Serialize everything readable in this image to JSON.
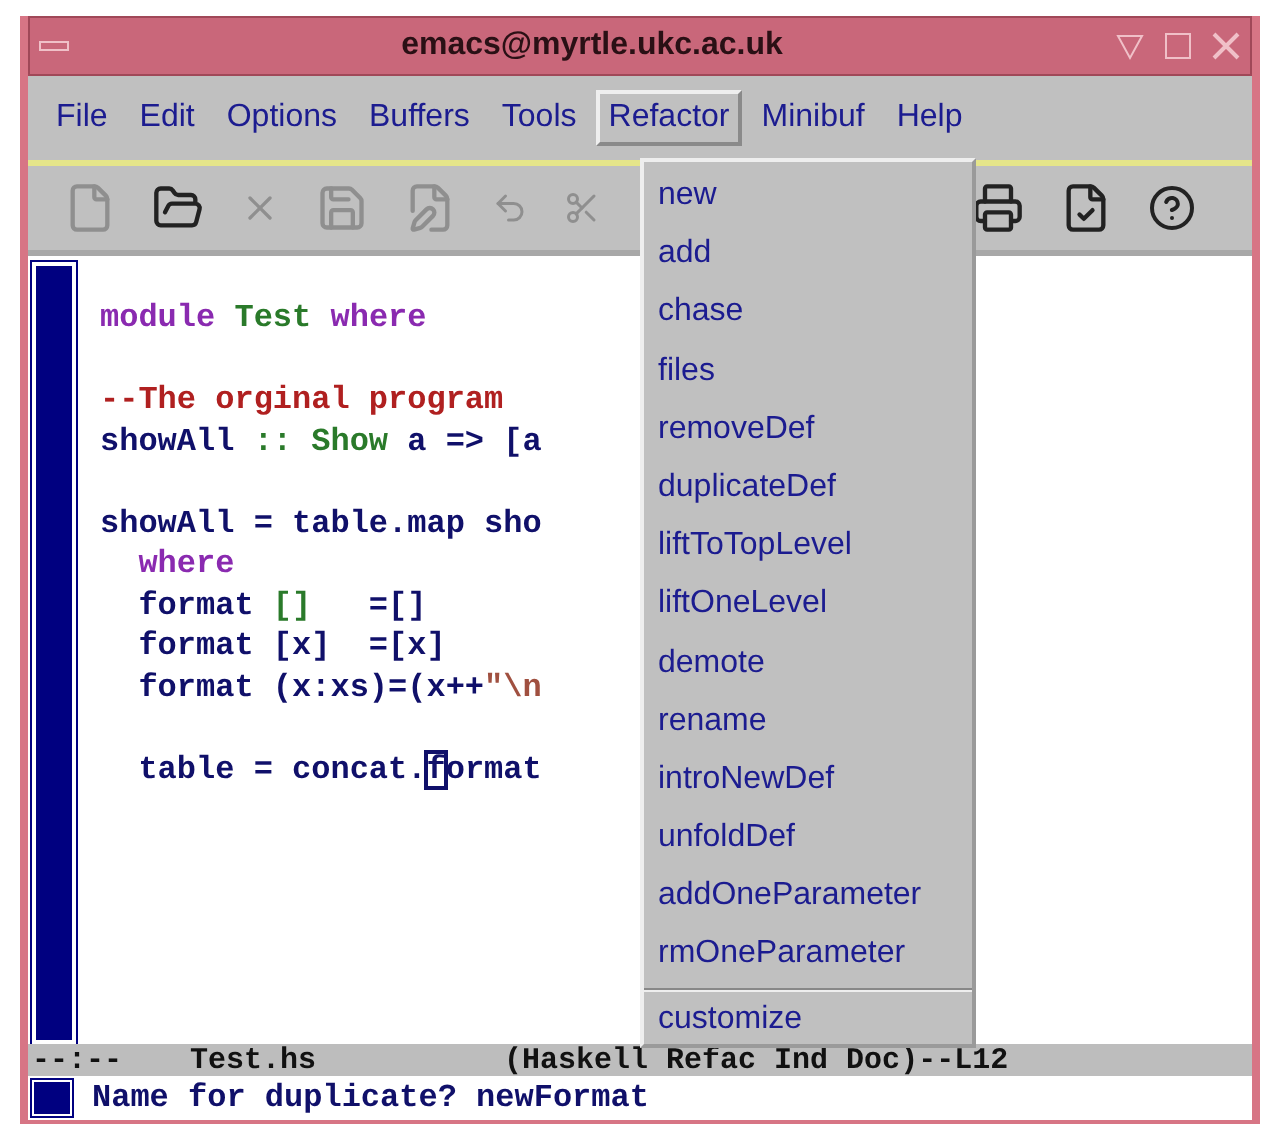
{
  "window": {
    "title": "emacs@myrtle.ukc.ac.uk"
  },
  "menubar": [
    {
      "label": "File",
      "selected": false
    },
    {
      "label": "Edit",
      "selected": false
    },
    {
      "label": "Options",
      "selected": false
    },
    {
      "label": "Buffers",
      "selected": false
    },
    {
      "label": "Tools",
      "selected": false
    },
    {
      "label": "Refactor",
      "selected": true
    },
    {
      "label": "Minibuf",
      "selected": false
    },
    {
      "label": "Help",
      "selected": false
    }
  ],
  "refactor_menu": {
    "items": [
      "new",
      "add",
      "chase",
      "files",
      "removeDef",
      "duplicateDef",
      "liftToTopLevel",
      "liftOneLevel",
      "demote",
      "rename",
      "introNewDef",
      "unfoldDef",
      "addOneParameter",
      "rmOneParameter"
    ],
    "footer_items": [
      "customize"
    ]
  },
  "editor": {
    "lines": [
      {
        "blank_before": false,
        "tokens": [
          {
            "kind": "keyword",
            "text": "module "
          },
          {
            "kind": "type",
            "text": "Test "
          },
          {
            "kind": "keyword",
            "text": "where"
          }
        ]
      },
      {
        "blank_before": true,
        "tokens": [
          {
            "kind": "comment",
            "text": "--The orginal program"
          }
        ]
      },
      {
        "blank_before": false,
        "tokens": [
          {
            "kind": "plain",
            "text": "showAll "
          },
          {
            "kind": "type",
            "text": ":: Show "
          },
          {
            "kind": "plain",
            "text": "a => [a"
          }
        ]
      },
      {
        "blank_before": true,
        "tokens": [
          {
            "kind": "plain",
            "text": "showAll = table.map sho"
          }
        ]
      },
      {
        "blank_before": false,
        "tokens": [
          {
            "kind": "keyword",
            "text": "  where"
          }
        ]
      },
      {
        "blank_before": false,
        "tokens": [
          {
            "kind": "plain",
            "text": "  format "
          },
          {
            "kind": "type",
            "text": "[]"
          },
          {
            "kind": "plain",
            "text": "   =[]"
          }
        ]
      },
      {
        "blank_before": false,
        "tokens": [
          {
            "kind": "plain",
            "text": "  format [x]  =[x]"
          }
        ]
      },
      {
        "blank_before": false,
        "tokens": [
          {
            "kind": "plain",
            "text": "  format (x:xs)=(x++"
          },
          {
            "kind": "string",
            "text": "\"\\n"
          }
        ]
      },
      {
        "blank_before": true,
        "tokens": [
          {
            "kind": "plain",
            "text": "  table = concat."
          },
          {
            "kind": "cursor",
            "text": "f"
          },
          {
            "kind": "plain",
            "text": "ormat"
          }
        ]
      }
    ]
  },
  "mode_line": {
    "status": "--:--",
    "buffer": "Test.hs",
    "modes": "(Haskell Refac Ind Doc)--L12"
  },
  "minibuffer": {
    "prompt": "Name for duplicate? newFormat"
  }
}
